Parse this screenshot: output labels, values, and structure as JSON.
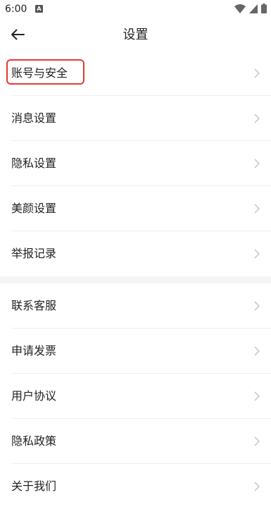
{
  "status_bar": {
    "time": "6:00",
    "notification_glyph": "A",
    "icons": [
      "wifi-icon",
      "signal-icon",
      "battery-icon"
    ]
  },
  "header": {
    "title": "设置",
    "back_icon": "arrow-left-icon"
  },
  "section1": [
    {
      "label": "账号与安全",
      "highlighted": true
    },
    {
      "label": "消息设置"
    },
    {
      "label": "隐私设置"
    },
    {
      "label": "美颜设置"
    },
    {
      "label": "举报记录"
    }
  ],
  "section2": [
    {
      "label": "联系客服"
    },
    {
      "label": "申请发票"
    },
    {
      "label": "用户协议"
    },
    {
      "label": "隐私政策"
    },
    {
      "label": "关于我们"
    }
  ],
  "colors": {
    "highlight_border": "#e53935",
    "chevron": "#c4c4c4",
    "section_gap": "#f4f4f4"
  }
}
